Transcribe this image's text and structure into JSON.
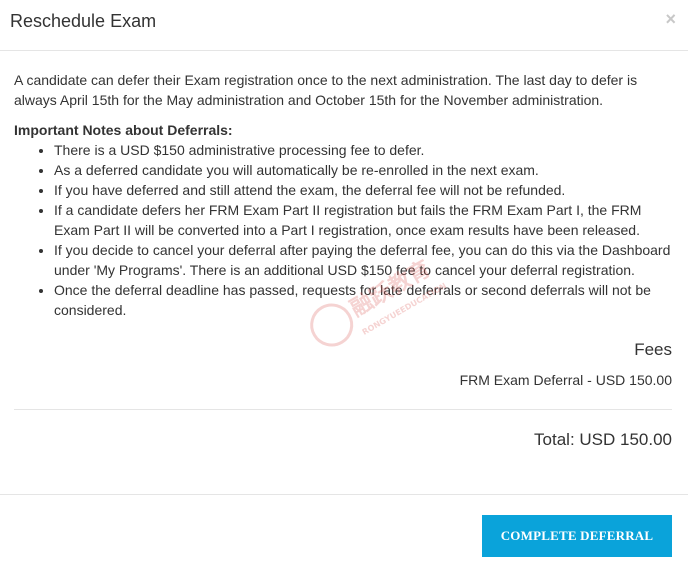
{
  "dialog": {
    "title": "Reschedule Exam",
    "close_glyph": "×"
  },
  "content": {
    "intro": "A candidate can defer their Exam registration once to the next administration. The last day to defer is always April 15th for the May administration and October 15th for the November administration.",
    "notes_heading": "Important Notes about Deferrals:",
    "notes": [
      "There is a USD $150 administrative processing fee to defer.",
      "As a deferred candidate you will automatically be re-enrolled in the next exam.",
      "If you have deferred and still attend the exam, the deferral fee will not be refunded.",
      "If a candidate defers her FRM Exam Part II registration but fails the FRM Exam Part I, the FRM Exam Part II will be converted into a Part I registration, once exam results have been released.",
      "If you decide to cancel your deferral after paying the deferral fee, you can do this via the Dashboard under 'My Programs'. There is an additional USD $150 fee to cancel your deferral registration.",
      "Once the deferral deadline has passed, requests for late deferrals or second deferrals will not be considered."
    ]
  },
  "fees": {
    "title": "Fees",
    "line_item": "FRM Exam Deferral - USD 150.00",
    "total": "Total: USD 150.00"
  },
  "footer": {
    "button_label": "COMPLETE DEFERRAL"
  },
  "watermark": {
    "text_main": "融跃教育",
    "text_sub": "RONGYUEEDUCATION"
  },
  "colors": {
    "button_bg": "#0aa3da",
    "watermark": "#d9534f"
  }
}
